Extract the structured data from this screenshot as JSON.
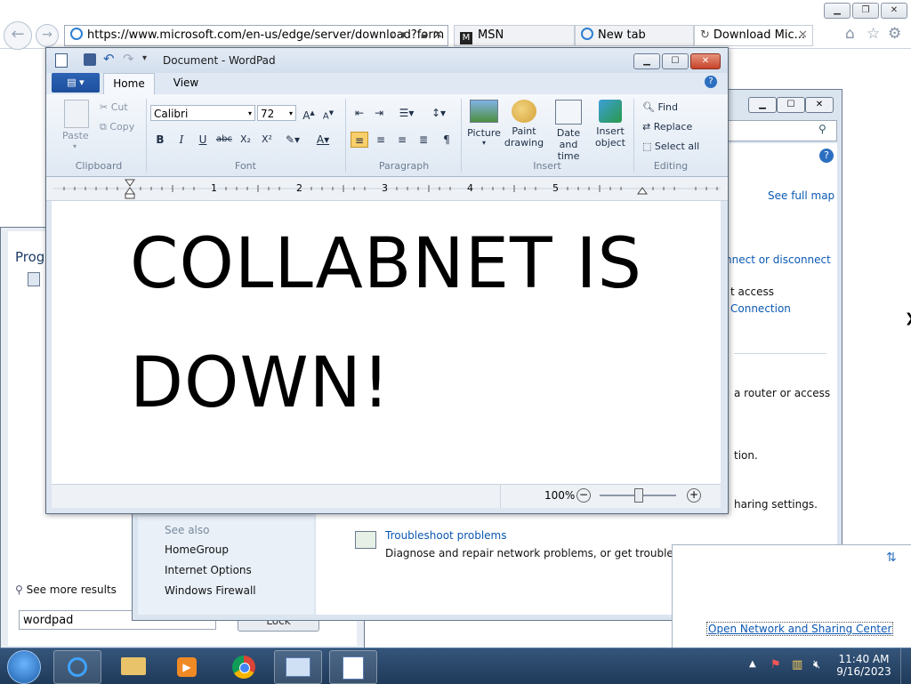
{
  "browser": {
    "address": "https://www.microsoft.com/en-us/edge/server/download?form",
    "tabs": [
      {
        "label": "MSN"
      },
      {
        "label": "New tab"
      },
      {
        "label": "Download Mic..."
      }
    ]
  },
  "start_search": {
    "heading": "Prog",
    "see_more": "See more results",
    "query": "wordpad",
    "lock_button": "Lock"
  },
  "network_center": {
    "see_full_map": "See full map",
    "right_texts": [
      "nnect or disconnect",
      "t access",
      " Connection",
      " a router or access",
      "tion.",
      "haring settings."
    ],
    "see_also": "See also",
    "see_also_items": [
      "HomeGroup",
      "Internet Options",
      "Windows Firewall"
    ],
    "troubleshoot_link": "Troubleshoot problems",
    "troubleshoot_desc": "Diagnose and repair network problems, or get troubleshooting information.",
    "open_link": "Open Network and Sharing Center"
  },
  "wordpad": {
    "title": "Document - WordPad",
    "tabs": [
      "Home",
      "View"
    ],
    "clipboard": {
      "paste": "Paste",
      "cut": "Cut",
      "copy": "Copy",
      "label": "Clipboard"
    },
    "font": {
      "family": "Calibri",
      "size": "72",
      "label": "Font"
    },
    "paragraph_label": "Paragraph",
    "insert": {
      "picture": "Picture",
      "paint1": "Paint",
      "paint2": "drawing",
      "date1": "Date and",
      "date2": "time",
      "obj1": "Insert",
      "obj2": "object",
      "label": "Insert"
    },
    "editing": {
      "find": "Find",
      "replace": "Replace",
      "select_all": "Select all",
      "label": "Editing"
    },
    "ruler_numbers": [
      "1",
      "2",
      "3",
      "4",
      "5"
    ],
    "content_line1": "COLLABNET IS",
    "content_line2": "DOWN!",
    "zoom": "100%",
    "zoom_level": 0.5
  },
  "taskbar": {
    "time": "11:40 AM",
    "date": "9/16/2023"
  }
}
